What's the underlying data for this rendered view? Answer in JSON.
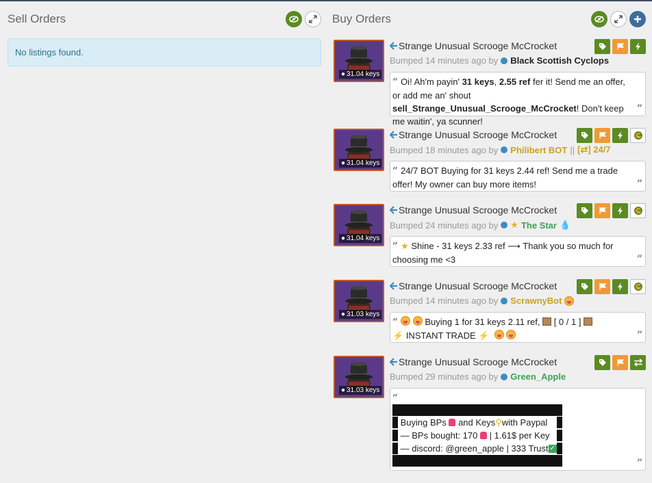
{
  "sell": {
    "title": "Sell Orders",
    "empty_text": "No listings found."
  },
  "buy": {
    "title": "Buy Orders",
    "listings": [
      {
        "price": "31.04 keys",
        "item_name": "Strange Unusual Scrooge McCrocket",
        "bumped_prefix": "Bumped 14 minutes ago by",
        "user": "Black Scottish Cyclops",
        "msg": {
          "a": "Oi! Ah'm payin' ",
          "b": "31 keys",
          "c": ", ",
          "d": "2.55 ref",
          "e": " fer it! Send me an offer, or add me an' shout ",
          "f": "sell_Strange_Unusual_Scrooge_McCrocket",
          "g": "! Don't keep me waitin', ya scunner!"
        }
      },
      {
        "price": "31.04 keys",
        "item_name": "Strange Unusual Scrooge McCrocket",
        "bumped_prefix": "Bumped 18 minutes ago by",
        "user": "Philibert BOT",
        "user_suffix_sep": "||",
        "user_suffix": "[⇄] 24/7",
        "msg": "24/7 BOT Buying for 31 keys 2.44 ref! Send me a trade offer! My owner can buy more items!"
      },
      {
        "price": "31.04 keys",
        "item_name": "Strange Unusual Scrooge McCrocket",
        "bumped_prefix": "Bumped 24 minutes ago by",
        "user": "The Star",
        "msg": "Shine - 31 keys 2.33 ref ⟶ Thank you so much for choosing me <3"
      },
      {
        "price": "31.03 keys",
        "item_name": "Strange Unusual Scrooge McCrocket",
        "bumped_prefix": "Bumped 14 minutes ago by",
        "user": "ScrawnyBot",
        "msg_a": "Buying 1 for 31 keys 2.11 ref,",
        "msg_b": "[ 0 / 1 ]",
        "msg_c": "INSTANT TRADE"
      },
      {
        "price": "31.03 keys",
        "item_name": "Strange Unusual Scrooge McCrocket",
        "bumped_prefix": "Bumped 29 minutes ago by",
        "user": "Green_Apple",
        "lines": [
          "Buying BPs",
          "and Keys",
          "with Paypal",
          "— BPs bought: 170",
          "| 1.61$ per Key",
          "— discord: @green_apple | 333 Trust"
        ]
      }
    ]
  },
  "icons": {
    "visibility": "eye-icon",
    "expand": "expand-icon",
    "add": "plus-icon",
    "tag": "tag-icon",
    "flag": "flag-icon",
    "bolt": "bolt-icon",
    "trade": "trade-arrows-icon",
    "profile": "g-badge-icon"
  },
  "colors": {
    "green": "#5b8b22",
    "orange": "#ef9a36",
    "blue": "#3d6d9a",
    "quality_border": "#c55a22",
    "item_bg": "#5a3a88",
    "info_bg": "#d9edf7"
  }
}
